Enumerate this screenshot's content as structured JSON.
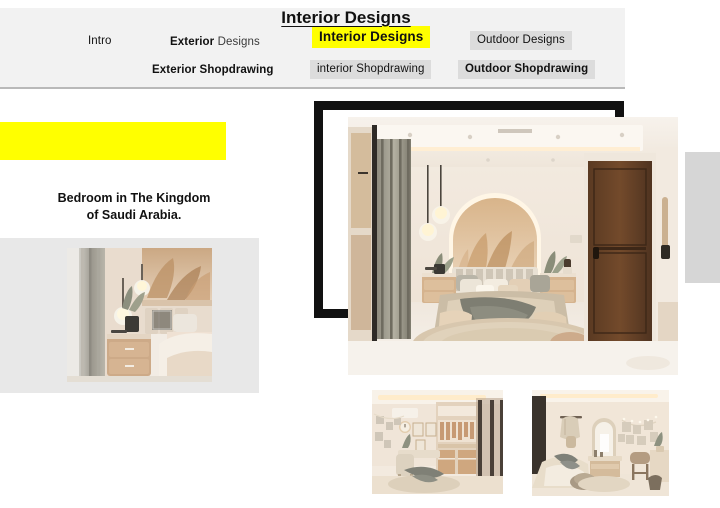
{
  "nav": {
    "items": [
      {
        "label": "Intro",
        "style": "plain",
        "id": "intro"
      },
      {
        "label": "Exterior Designs",
        "style": "plain",
        "id": "exterior-designs",
        "bold_part": "Exterior",
        "light_part": "Designs"
      },
      {
        "label": "Interior Designs",
        "style": "yellow",
        "id": "interior-designs",
        "active": true
      },
      {
        "label": "Outdoor Designs",
        "style": "chip",
        "id": "outdoor-designs"
      },
      {
        "label": "Exterior Shopdrawing",
        "style": "plain",
        "id": "exterior-shopdrawing"
      },
      {
        "label": "interior Shopdrawing",
        "style": "chip",
        "id": "interior-shopdrawing"
      },
      {
        "label": "Outdoor Shopdrawing",
        "style": "chip",
        "id": "outdoor-shopdrawing"
      }
    ]
  },
  "section": {
    "title": "Interior Designs",
    "caption_line1": "Bedroom in The Kingdom",
    "caption_line2": "of Saudi Arabia."
  },
  "gallery": {
    "hero_alt": "bedroom-render-arched-headboard",
    "left_thumb_alt": "bedroom-nightstand-closeup",
    "thumb_a_alt": "bedroom-with-walk-in-closet",
    "thumb_b_alt": "bedroom-with-vanity-mirror"
  },
  "colors": {
    "highlight": "#ffff00",
    "nav_bar": "#f2f2f2",
    "chip": "#dcdcdc",
    "panel_gray": "#e8e8e8",
    "block_gray": "#d6d6d6",
    "frame": "#111111"
  }
}
